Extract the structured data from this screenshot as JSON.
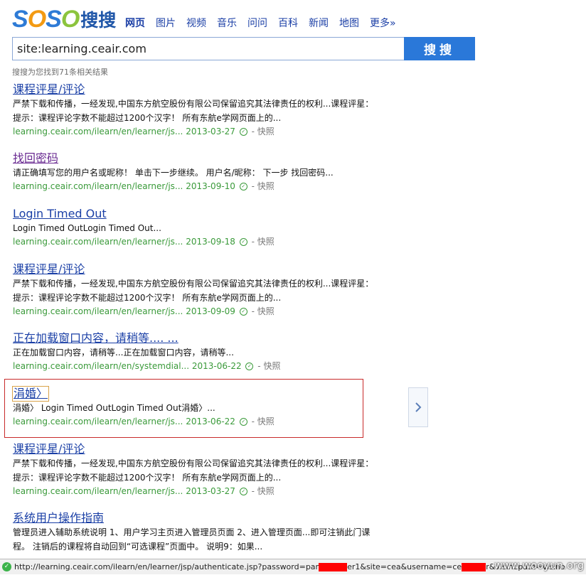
{
  "logo": {
    "latin": [
      "S",
      "O",
      "S",
      "O"
    ],
    "chinese": "搜搜"
  },
  "nav": [
    {
      "label": "网页",
      "active": true
    },
    {
      "label": "图片"
    },
    {
      "label": "视频"
    },
    {
      "label": "音乐"
    },
    {
      "label": "问问"
    },
    {
      "label": "百科"
    },
    {
      "label": "新闻"
    },
    {
      "label": "地图"
    },
    {
      "label": "更多»"
    }
  ],
  "search": {
    "value": "site:learning.ceair.com",
    "button": "搜搜"
  },
  "result_count": "搜搜为您找到71条相关结果",
  "results": [
    {
      "title": "课程评星/评论",
      "snippet1": "严禁下载和传播，一经发现,中国东方航空股份有限公司保留追究其法律责任的权利...课程评星：",
      "snippet2": "提示：课程评论字数不能超过1200个汉字！ 所有东航e学网页面上的...",
      "url": "learning.ceair.com/ilearn/en/learner/js...",
      "date": "2013-03-27",
      "snapshot": "快照"
    },
    {
      "title": "找回密码",
      "snippet1": "请正确填写您的用户名或昵称！ 单击下一步继续。 用户名/昵称： 下一步 找回密码...",
      "url": "learning.ceair.com/ilearn/en/learner/js...",
      "date": "2013-09-10",
      "snapshot": "快照"
    },
    {
      "title": "Login Timed Out",
      "snippet1": "Login Timed OutLogin Timed Out...",
      "url": "learning.ceair.com/ilearn/en/learner/js...",
      "date": "2013-09-18",
      "snapshot": "快照"
    },
    {
      "title": "课程评星/评论",
      "snippet1": "严禁下载和传播，一经发现,中国东方航空股份有限公司保留追究其法律责任的权利...课程评星：",
      "snippet2": "提示：课程评论字数不能超过1200个汉字！ 所有东航e学网页面上的...",
      "url": "learning.ceair.com/ilearn/en/learner/js...",
      "date": "2013-09-09",
      "snapshot": "快照"
    },
    {
      "title": "正在加载窗口内容，请稍等.... ...",
      "snippet1": "正在加载窗口内容，请稍等...正在加载窗口内容，请稍等...",
      "url": "learning.ceair.com/ilearn/en/systemdial...",
      "date": "2013-06-22",
      "snapshot": "快照"
    },
    {
      "title": "涓婚〉",
      "snippet1": "涓婚〉 Login Timed OutLogin Timed Out涓婚〉...",
      "url": "learning.ceair.com/ilearn/en/learner/js...",
      "date": "2013-06-22",
      "snapshot": "快照"
    },
    {
      "title": "课程评星/评论",
      "snippet1": "严禁下载和传播，一经发现,中国东方航空股份有限公司保留追究其法律责任的权利...课程评星：",
      "snippet2": "提示：课程评论字数不能超过1200个汉字！ 所有东航e学网页面上的...",
      "url": "learning.ceair.com/ilearn/en/learner/js...",
      "date": "2013-03-27",
      "snapshot": "快照"
    },
    {
      "title": "系统用户操作指南",
      "snippet1": "管理员进入辅助系统说明 1、用户学习主页进入管理员页面 2、进入管理页面...即可注销此门课",
      "snippet2": "程。 注销后的课程将自动回到“可选课程”页面中。 说明9：如果..."
    }
  ],
  "status_bar": {
    "part1": "http://learning.ceair.com/ilearn/en/learner/jsp/authenticate.jsp?password=par",
    "part2": "er1&site=cea&username=ce",
    "part3": "r&visinopath=visino"
  },
  "watermark": "www.wooyun.org",
  "colors": {
    "link": "#1a3fa6",
    "visited": "#6a2b92",
    "url": "#3a9a3a",
    "highlight_box": "#c82a2a",
    "search_button": "#2a78d9"
  }
}
